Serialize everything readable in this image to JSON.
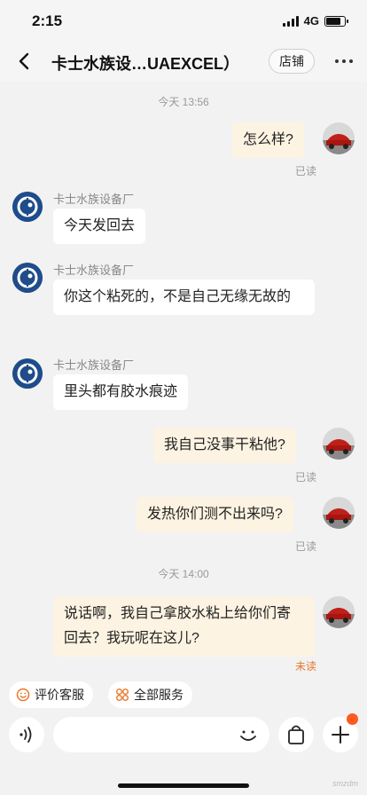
{
  "status_bar": {
    "time": "2:15",
    "network": "4G",
    "battery_level": 0.8
  },
  "nav": {
    "title": "卡士水族设…UAEXCEL）",
    "shop_button": "店铺",
    "back_icon": "chevron-left-icon",
    "more_icon": "more-horizontal-icon"
  },
  "chat": {
    "timestamps": [
      "今天 13:56",
      "今天 14:00"
    ],
    "sender_name": "卡士水族设备厂",
    "messages": [
      {
        "side": "out",
        "text": "怎么样?",
        "status": "已读"
      },
      {
        "side": "in",
        "text": "今天发回去"
      },
      {
        "side": "in",
        "text": "你这个粘死的，不是自己无缘无故的"
      },
      {
        "side": "in",
        "text": "里头都有胶水痕迹"
      },
      {
        "side": "out",
        "text": "我自己没事干粘他?",
        "status": "已读"
      },
      {
        "side": "out",
        "text": "发热你们测不出来吗?",
        "status": "已读"
      },
      {
        "side": "out",
        "text": "说话啊，我自己拿胶水粘上给你们寄回去？我玩呢在这儿?",
        "status": "未读"
      }
    ]
  },
  "quick_actions": [
    {
      "label": "评价客服",
      "icon": "smile-icon"
    },
    {
      "label": "全部服务",
      "icon": "grid-icon"
    }
  ],
  "input": {
    "placeholder": "",
    "voice_icon": "voice-icon",
    "emoji_icon": "emoji-icon",
    "bag_icon": "shopping-bag-icon",
    "plus_icon": "plus-icon"
  },
  "colors": {
    "outgoing_bubble": "#fdf3e2",
    "incoming_bubble": "#ffffff",
    "unread": "#e8782c",
    "badge": "#ff5a1f",
    "shop_avatar": "#1f4c8a"
  },
  "watermark": "smzdm"
}
